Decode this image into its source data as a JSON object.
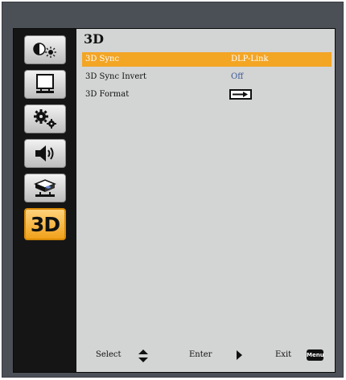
{
  "menu": {
    "title": "3D",
    "rows": [
      {
        "label": "3D Sync",
        "value": "DLP-Link",
        "selected": true
      },
      {
        "label": "3D Sync Invert",
        "value": "Off",
        "selected": false
      },
      {
        "label": "3D Format",
        "value_icon": "arrow-right-icon",
        "selected": false
      }
    ]
  },
  "sidebar": {
    "tabs": [
      {
        "icon": "brightness-icon",
        "active": false
      },
      {
        "icon": "display-screen-icon",
        "active": false
      },
      {
        "icon": "gears-icon",
        "active": false
      },
      {
        "icon": "speaker-icon",
        "active": false
      },
      {
        "icon": "projector-icon",
        "active": false
      },
      {
        "label": "3D",
        "active": true
      }
    ]
  },
  "footer": {
    "select_label": "Select",
    "enter_label": "Enter",
    "exit_label": "Exit",
    "menu_key_label": "Menu"
  },
  "colors": {
    "accent": "#f3a524",
    "panel": "#d3d4d4",
    "value_text": "#3c5a96"
  }
}
